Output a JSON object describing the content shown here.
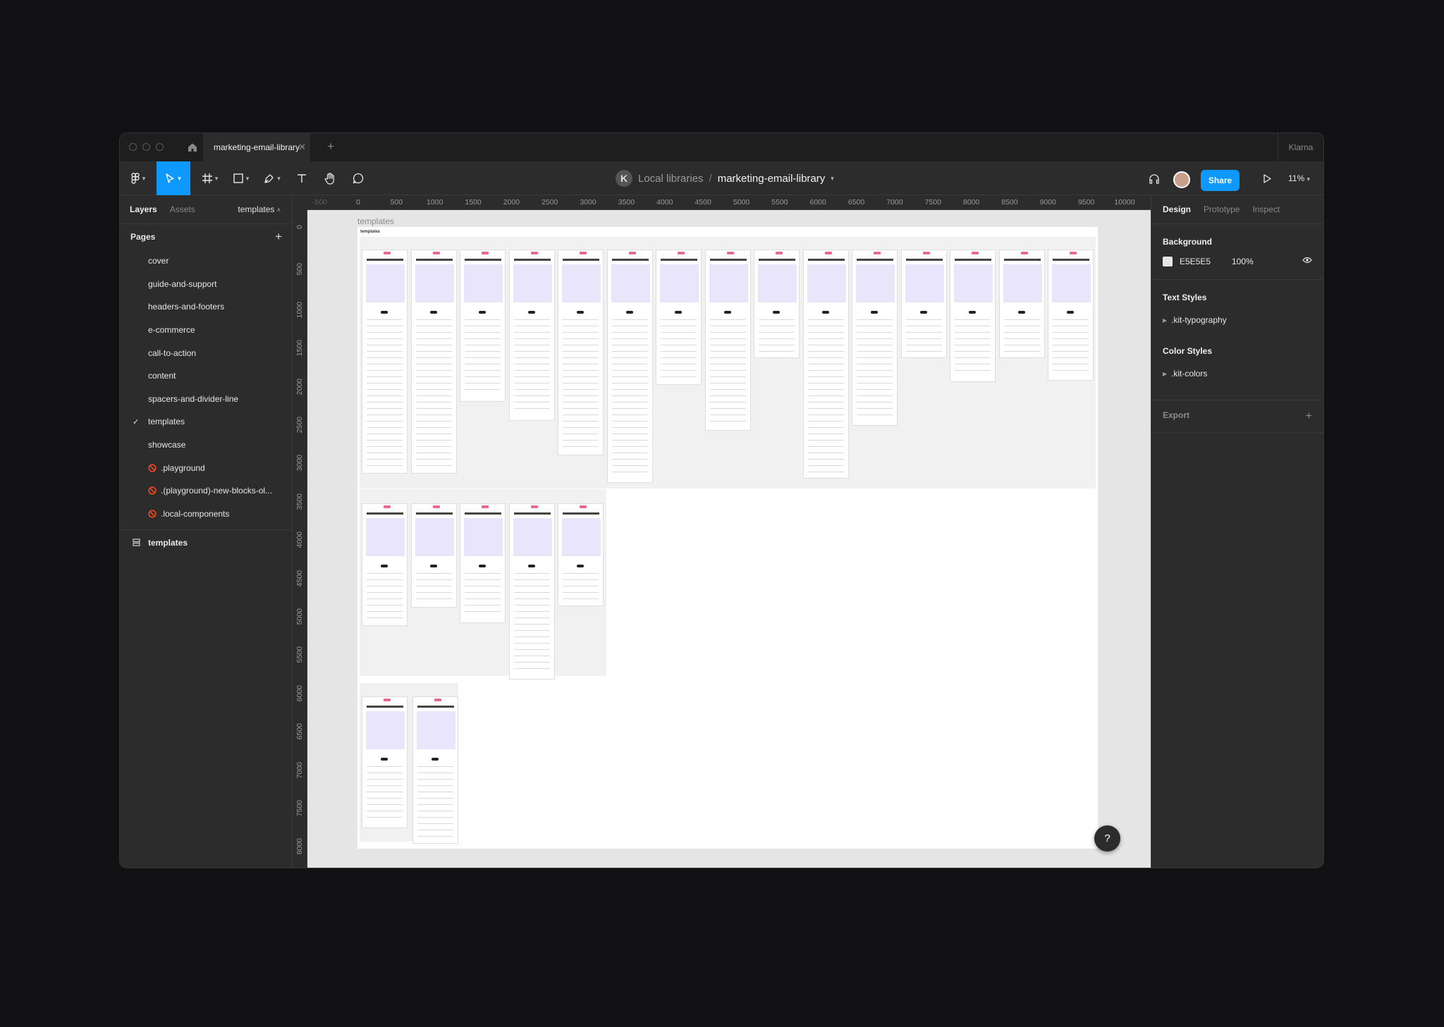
{
  "titlebar": {
    "tab_title": "marketing-email-library",
    "team_name": "Klarna"
  },
  "toolbar": {
    "avatar_letter": "K",
    "project": "Local libraries",
    "separator": "/",
    "file_name": "marketing-email-library",
    "share_label": "Share",
    "zoom": "11%"
  },
  "left_panel": {
    "tabs": [
      "Layers",
      "Assets"
    ],
    "page_selector": "templates",
    "pages_title": "Pages",
    "pages": [
      {
        "name": "cover",
        "state": "normal"
      },
      {
        "name": "guide-and-support",
        "state": "normal"
      },
      {
        "name": "headers-and-footers",
        "state": "normal"
      },
      {
        "name": "e-commerce",
        "state": "normal"
      },
      {
        "name": "call-to-action",
        "state": "normal"
      },
      {
        "name": "content",
        "state": "normal"
      },
      {
        "name": "spacers-and-divider-line",
        "state": "normal"
      },
      {
        "name": "templates",
        "state": "current"
      },
      {
        "name": "showcase",
        "state": "normal"
      },
      {
        "name": ".playground",
        "state": "banned"
      },
      {
        "name": ".(playground)-new-blocks-ol...",
        "state": "banned"
      },
      {
        "name": ".local-components",
        "state": "banned"
      }
    ],
    "layer": "templates"
  },
  "right_panel": {
    "tabs": [
      "Design",
      "Prototype",
      "Inspect"
    ],
    "background_title": "Background",
    "background_hex": "E5E5E5",
    "background_opacity": "100%",
    "text_styles_title": "Text Styles",
    "text_style": ".kit-typography",
    "color_styles_title": "Color Styles",
    "color_style": ".kit-colors",
    "export_title": "Export"
  },
  "canvas": {
    "frame_label": "templates",
    "frame_inner_label": "templates",
    "ruler_x": [
      "-500",
      "0",
      "500",
      "1000",
      "1500",
      "2000",
      "2500",
      "3000",
      "3500",
      "4000",
      "4500",
      "5000",
      "5500",
      "6000",
      "6500",
      "7000",
      "7500",
      "8000",
      "8500",
      "9000",
      "9500",
      "10000"
    ],
    "ruler_y": [
      "0",
      "500",
      "1000",
      "1500",
      "2000",
      "2500",
      "3000",
      "3500",
      "4000",
      "4500",
      "5000",
      "5500",
      "6000",
      "6500",
      "7000",
      "7500",
      "8000"
    ]
  },
  "help_label": "?",
  "colors": {
    "accent": "#0d99ff",
    "canvas_bg": "#E5E5E5",
    "badge": "#e86a8e",
    "hero": "#e9e5fb"
  }
}
